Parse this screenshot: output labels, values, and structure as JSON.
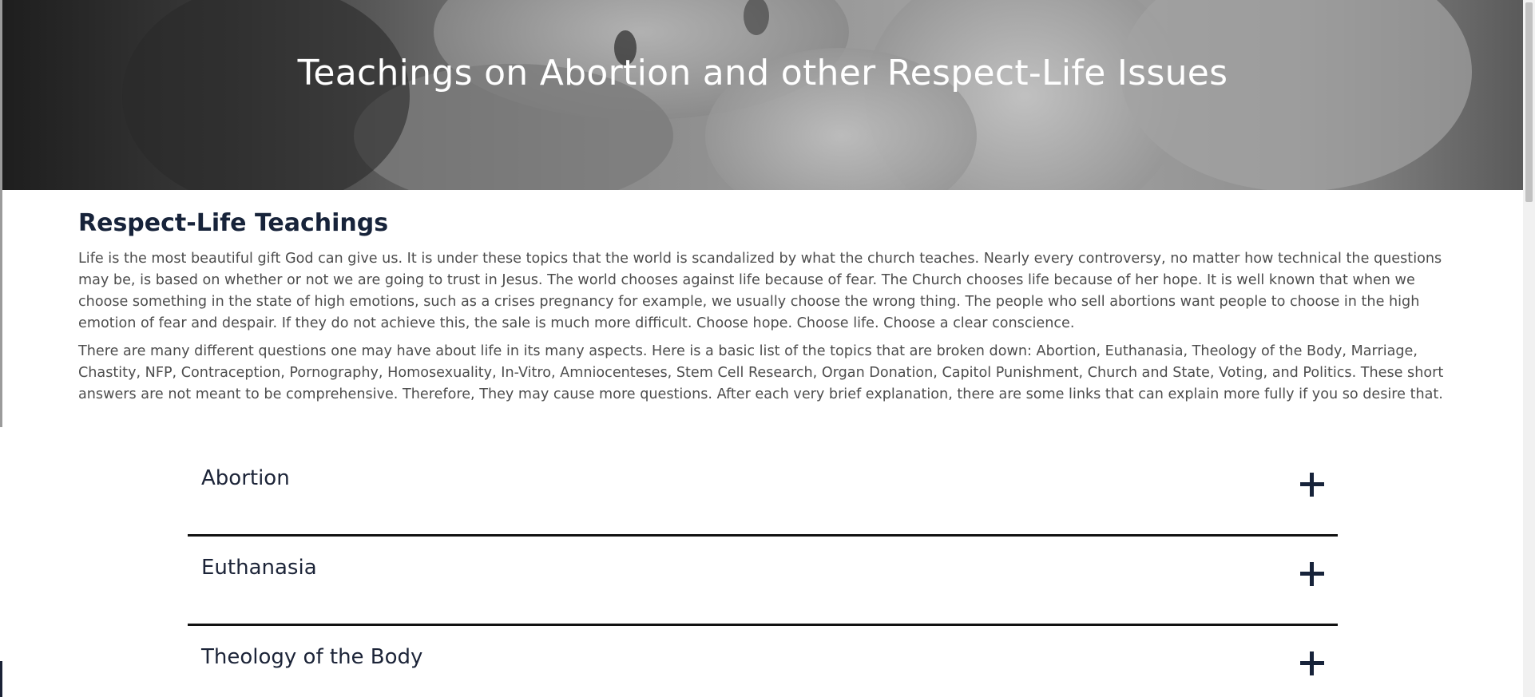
{
  "hero": {
    "title": "Teachings on Abortion and other Respect-Life Issues"
  },
  "section": {
    "title": "Respect-Life Teachings",
    "paragraphs": [
      "Life is the most beautiful gift God can give us. It is under these topics that the world is scandalized by what the church teaches. Nearly every controversy, no matter how technical the questions may be, is based on whether or not we are going to trust in Jesus. The world chooses against life because of fear.  The Church chooses life because of her hope. It is well known that when we choose something in the state of high emotions, such as a crises pregnancy for example, we usually choose the wrong thing. The people who sell abortions want people to choose in the high emotion of fear and despair. If they do not achieve this, the sale is much more difficult. Choose hope. Choose life. Choose a clear conscience.",
      "There are many different questions one may have about life in its many aspects. Here is a basic list of the topics that are broken down: Abortion, Euthanasia, Theology of the Body, Marriage, Chastity, NFP, Contraception, Pornography, Homosexuality, In-Vitro, Amniocenteses, Stem Cell Research, Organ Donation, Capitol Punishment, Church and State, Voting, and Politics. These short answers are not meant to be comprehensive. Therefore, They may cause more questions. After each very brief explanation, there are some links that can explain more fully if you so desire that."
    ]
  },
  "accordion": {
    "items": [
      {
        "label": "Abortion",
        "icon": "plus-icon"
      },
      {
        "label": "Euthanasia",
        "icon": "plus-icon"
      },
      {
        "label": "Theology of the Body",
        "icon": "plus-icon"
      }
    ]
  },
  "colors": {
    "heading": "#17233a",
    "body_text": "#4d4d4d",
    "divider": "#111111",
    "hero_text": "#ffffff"
  }
}
